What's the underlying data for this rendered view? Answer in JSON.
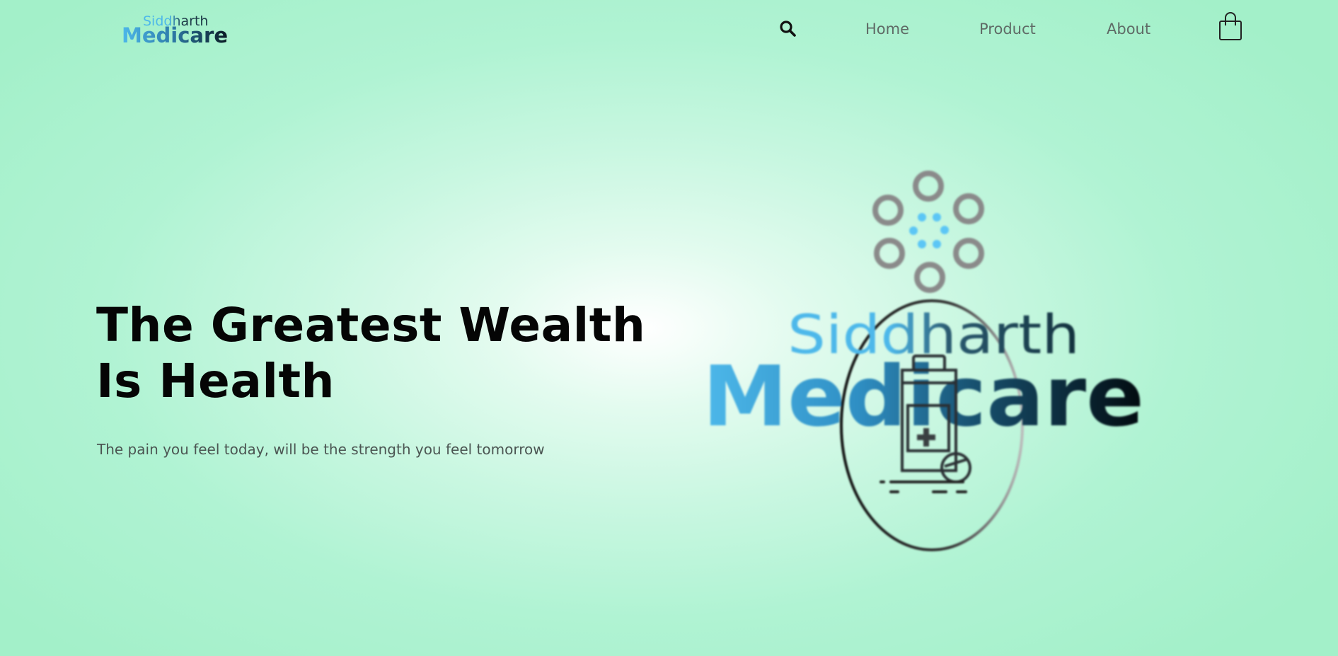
{
  "header": {
    "brand": {
      "line1": "Siddharth",
      "line2": "Medicare"
    },
    "search_icon": "search-icon",
    "nav": {
      "home": "Home",
      "product": "Product",
      "about": "About"
    },
    "cart_icon": "shopping-bag-icon"
  },
  "hero": {
    "title_line1": "The Greatest Wealth",
    "title_line2": "Is Health",
    "subtitle": "The pain you feel today, will be the strength you feel tomorrow",
    "logo": {
      "line1": "Siddharth",
      "line2": "Medicare"
    }
  },
  "colors": {
    "background_center": "#ffffff",
    "background_edge": "#a3f0c9",
    "brand_blue": "#4db8ea",
    "brand_dark": "#0a1a22",
    "ring_gray": "#8a8a8a",
    "dot_blue": "#5cc6f5",
    "nav_text": "#5f6b66",
    "heading": "#050505",
    "subtitle": "#4b5552"
  }
}
